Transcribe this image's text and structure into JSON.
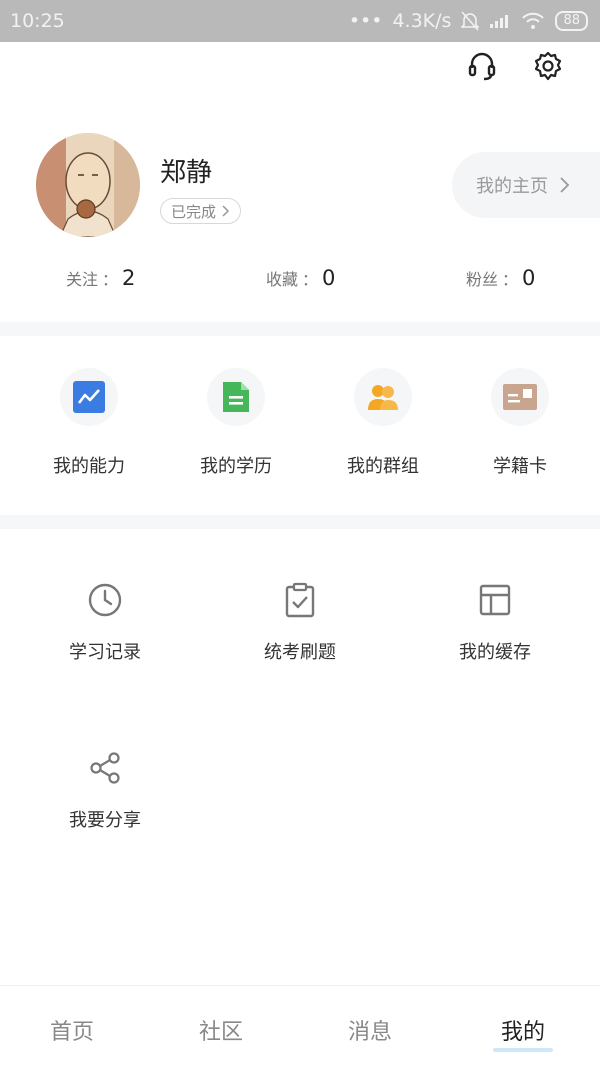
{
  "status_bar": {
    "time": "10:25",
    "dots": "•••",
    "speed": "4.3K/s",
    "battery": "88"
  },
  "header": {
    "icons": [
      "headset-icon",
      "gear-icon"
    ]
  },
  "profile": {
    "name": "郑静",
    "badge": "已完成",
    "homepage_label": "我的主页"
  },
  "stats": [
    {
      "label": "关注",
      "value": "2"
    },
    {
      "label": "收藏",
      "value": "0"
    },
    {
      "label": "粉丝",
      "value": "0"
    }
  ],
  "colon": "：",
  "primary_menu": [
    {
      "label": "我的能力",
      "icon": "ability-chart-icon",
      "color": "#3b7ce3"
    },
    {
      "label": "我的学历",
      "icon": "education-doc-icon",
      "color": "#45b65a"
    },
    {
      "label": "我的群组",
      "icon": "group-people-icon",
      "color": "#f5a623"
    },
    {
      "label": "学籍卡",
      "icon": "student-card-icon",
      "color": "#c9a48f"
    }
  ],
  "secondary_menu": [
    {
      "label": "学习记录",
      "icon": "clock-icon"
    },
    {
      "label": "统考刷题",
      "icon": "clipboard-check-icon"
    },
    {
      "label": "我的缓存",
      "icon": "layout-icon"
    },
    {
      "label": "我要分享",
      "icon": "share-icon"
    }
  ],
  "bottom_nav": [
    {
      "label": "首页",
      "active": false
    },
    {
      "label": "社区",
      "active": false
    },
    {
      "label": "消息",
      "active": false
    },
    {
      "label": "我的",
      "active": true
    }
  ]
}
